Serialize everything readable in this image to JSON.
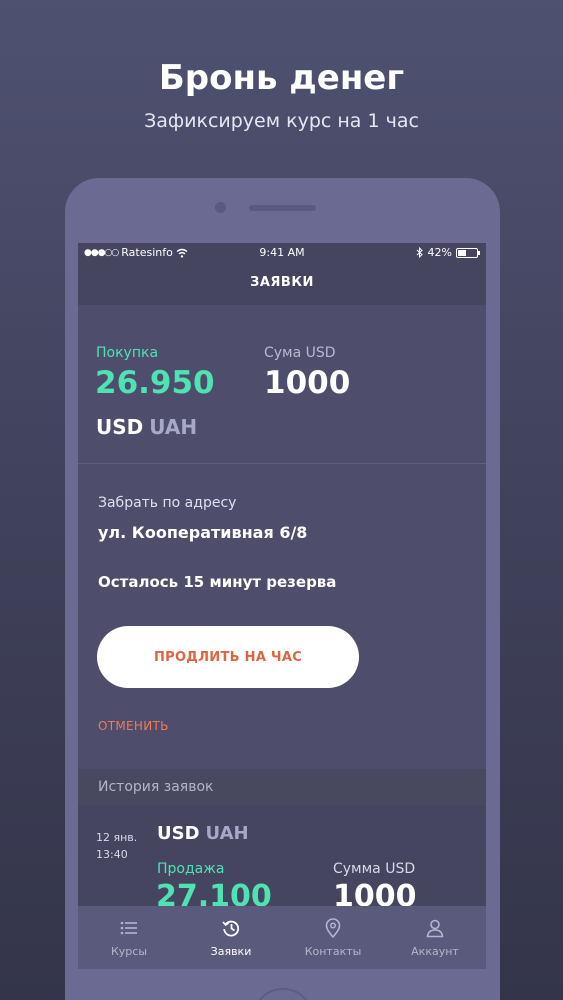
{
  "promo": {
    "title": "Бронь денег",
    "subtitle": "Зафиксируем курс на 1 час"
  },
  "status_bar": {
    "signal": "●●●○○",
    "carrier": "Ratesinfo",
    "time": "9:41 AM",
    "battery": "42%"
  },
  "nav": {
    "title": "ЗАЯВКИ"
  },
  "order": {
    "buy_label": "Покупка",
    "buy_rate": "26.950",
    "sum_label": "Сума USD",
    "sum_value": "1000",
    "currency_from": "USD",
    "currency_to": "UAH",
    "pickup_label": "Забрать по адресу",
    "pickup_address": "ул. Кооперативная 6/8",
    "remaining": "Осталось 15 минут резерва",
    "extend_button": "ПРОДЛИТЬ НА ЧАС",
    "cancel_link": "ОТМЕНИТЬ"
  },
  "history": {
    "header": "История заявок",
    "items": [
      {
        "date": "12 янв.",
        "time": "13:40",
        "currency_from": "USD",
        "currency_to": "UAH",
        "sell_label": "Продажа",
        "sell_rate": "27.100",
        "sum_label": "Сумма USD",
        "sum_value": "1000"
      }
    ]
  },
  "tabs": [
    {
      "label": "Курсы",
      "icon": "list-icon",
      "active": false
    },
    {
      "label": "Заявки",
      "icon": "history-icon",
      "active": true
    },
    {
      "label": "Контакты",
      "icon": "location-pin-icon",
      "active": false
    },
    {
      "label": "Аккаунт",
      "icon": "user-icon",
      "active": false
    }
  ],
  "colors": {
    "accent_green": "#4fe3b3",
    "accent_orange": "#e0643f",
    "screen_bg": "#45455f"
  }
}
